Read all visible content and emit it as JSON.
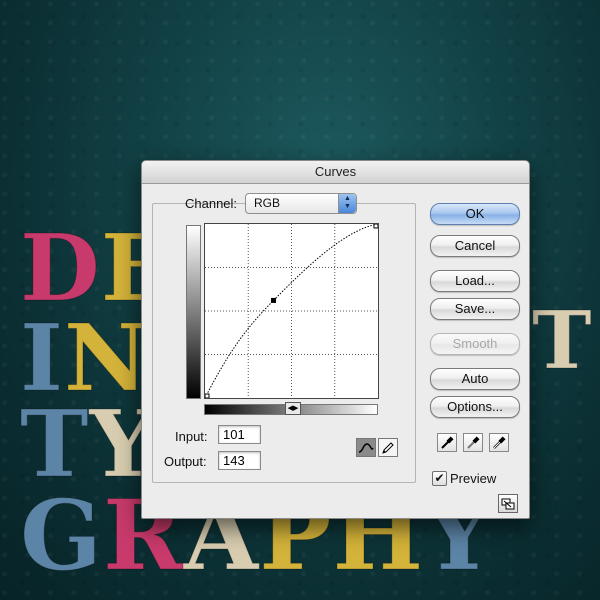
{
  "dialog": {
    "title": "Curves",
    "channel_label": "Channel:",
    "channel_value": "RGB",
    "input_label": "Input:",
    "input_value": "101",
    "output_label": "Output:",
    "output_value": "143",
    "buttons": {
      "ok": "OK",
      "cancel": "Cancel",
      "load": "Load...",
      "save": "Save...",
      "smooth": "Smooth",
      "auto": "Auto",
      "options": "Options..."
    },
    "preview_label": "Preview",
    "preview_checked": true,
    "curve_points": [
      {
        "input": 0,
        "output": 0
      },
      {
        "input": 101,
        "output": 143
      },
      {
        "input": 255,
        "output": 255
      }
    ],
    "tools": [
      "curve-tool-icon",
      "pencil-tool-icon"
    ],
    "eyedroppers": [
      "black-eyedropper-icon",
      "gray-eyedropper-icon",
      "white-eyedropper-icon"
    ]
  },
  "background": {
    "lines": [
      [
        "D",
        "E"
      ],
      [
        "I",
        "N"
      ],
      [
        "T",
        "Y"
      ],
      [
        "G",
        "R",
        "A",
        "P",
        "H",
        "Y"
      ]
    ],
    "right_fragments": [
      "T"
    ],
    "colors": {
      "teal": "#124246",
      "yellow": "#d4b33a",
      "blue": "#5b84a6",
      "cream": "#d8cdb0",
      "pink": "#c83a6b"
    }
  }
}
